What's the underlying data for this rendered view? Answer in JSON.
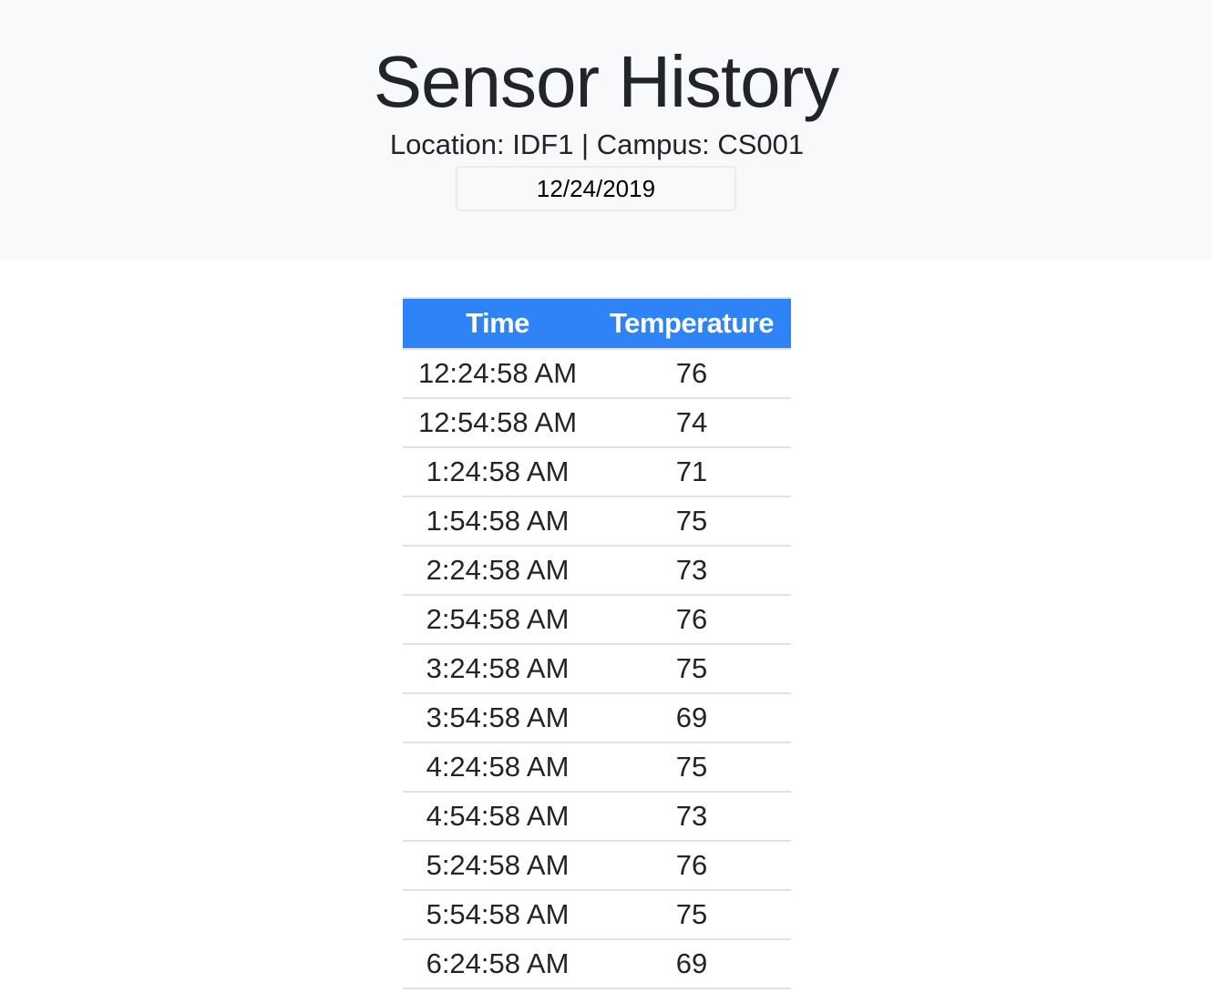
{
  "header": {
    "title": "Sensor History",
    "subtitle": "Location: IDF1 | Campus: CS001",
    "date_value": "12/24/2019"
  },
  "table": {
    "columns": [
      "Time",
      "Temperature"
    ],
    "rows": [
      {
        "time": "12:24:58 AM",
        "temperature": "76"
      },
      {
        "time": "12:54:58 AM",
        "temperature": "74"
      },
      {
        "time": "1:24:58 AM",
        "temperature": "71"
      },
      {
        "time": "1:54:58 AM",
        "temperature": "75"
      },
      {
        "time": "2:24:58 AM",
        "temperature": "73"
      },
      {
        "time": "2:54:58 AM",
        "temperature": "76"
      },
      {
        "time": "3:24:58 AM",
        "temperature": "75"
      },
      {
        "time": "3:54:58 AM",
        "temperature": "69"
      },
      {
        "time": "4:24:58 AM",
        "temperature": "75"
      },
      {
        "time": "4:54:58 AM",
        "temperature": "73"
      },
      {
        "time": "5:24:58 AM",
        "temperature": "76"
      },
      {
        "time": "5:54:58 AM",
        "temperature": "75"
      },
      {
        "time": "6:24:58 AM",
        "temperature": "69"
      }
    ]
  },
  "colors": {
    "header_background": "#f8f9fa",
    "table_header_background": "#2e84f7",
    "table_header_text": "#ffffff",
    "text": "#212529",
    "row_border": "#dee2e6"
  }
}
